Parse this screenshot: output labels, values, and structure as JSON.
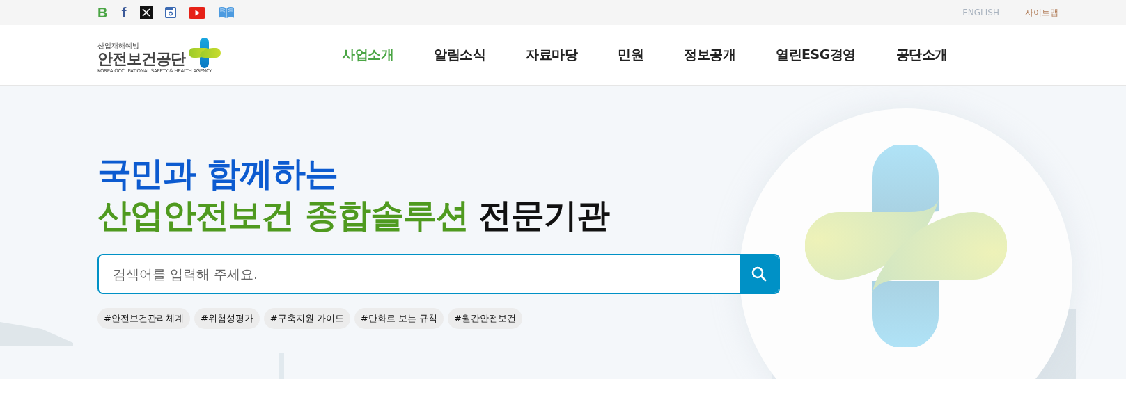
{
  "social_links": [
    {
      "kind": "blog",
      "glyph": "B"
    },
    {
      "kind": "facebook",
      "glyph": "f"
    },
    {
      "kind": "x"
    },
    {
      "kind": "instagram"
    },
    {
      "kind": "youtube"
    },
    {
      "kind": "book"
    }
  ],
  "utility_links": [
    "ENGLISH",
    "사이트맵"
  ],
  "logo": {
    "tagline": "산업재해예방",
    "name": "안전보건공단",
    "english": "KOREA OCCUPATIONAL SAFETY & HEALTH AGENCY"
  },
  "nav": [
    {
      "label": "사업소개",
      "selected": true
    },
    {
      "label": "알림소식",
      "selected": false
    },
    {
      "label": "자료마당",
      "selected": false
    },
    {
      "label": "민원",
      "selected": false
    },
    {
      "label": "정보공개",
      "selected": false
    },
    {
      "label": "열린ESG경영",
      "selected": false
    },
    {
      "label": "공단소개",
      "selected": false
    }
  ],
  "hero": {
    "headline_line_1": "국민과 함께하는",
    "headline_line_2": {
      "highlight": "산업안전보건 종합솔루션",
      "rest": "전문기관"
    }
  },
  "search": {
    "placeholder": "검색어를 입력해 주세요."
  },
  "tags": [
    "#안전보건관리체계",
    "#위험성평가",
    "#구축지원 가이드",
    "#만화로 보는 규칙",
    "#월간안전보건"
  ]
}
